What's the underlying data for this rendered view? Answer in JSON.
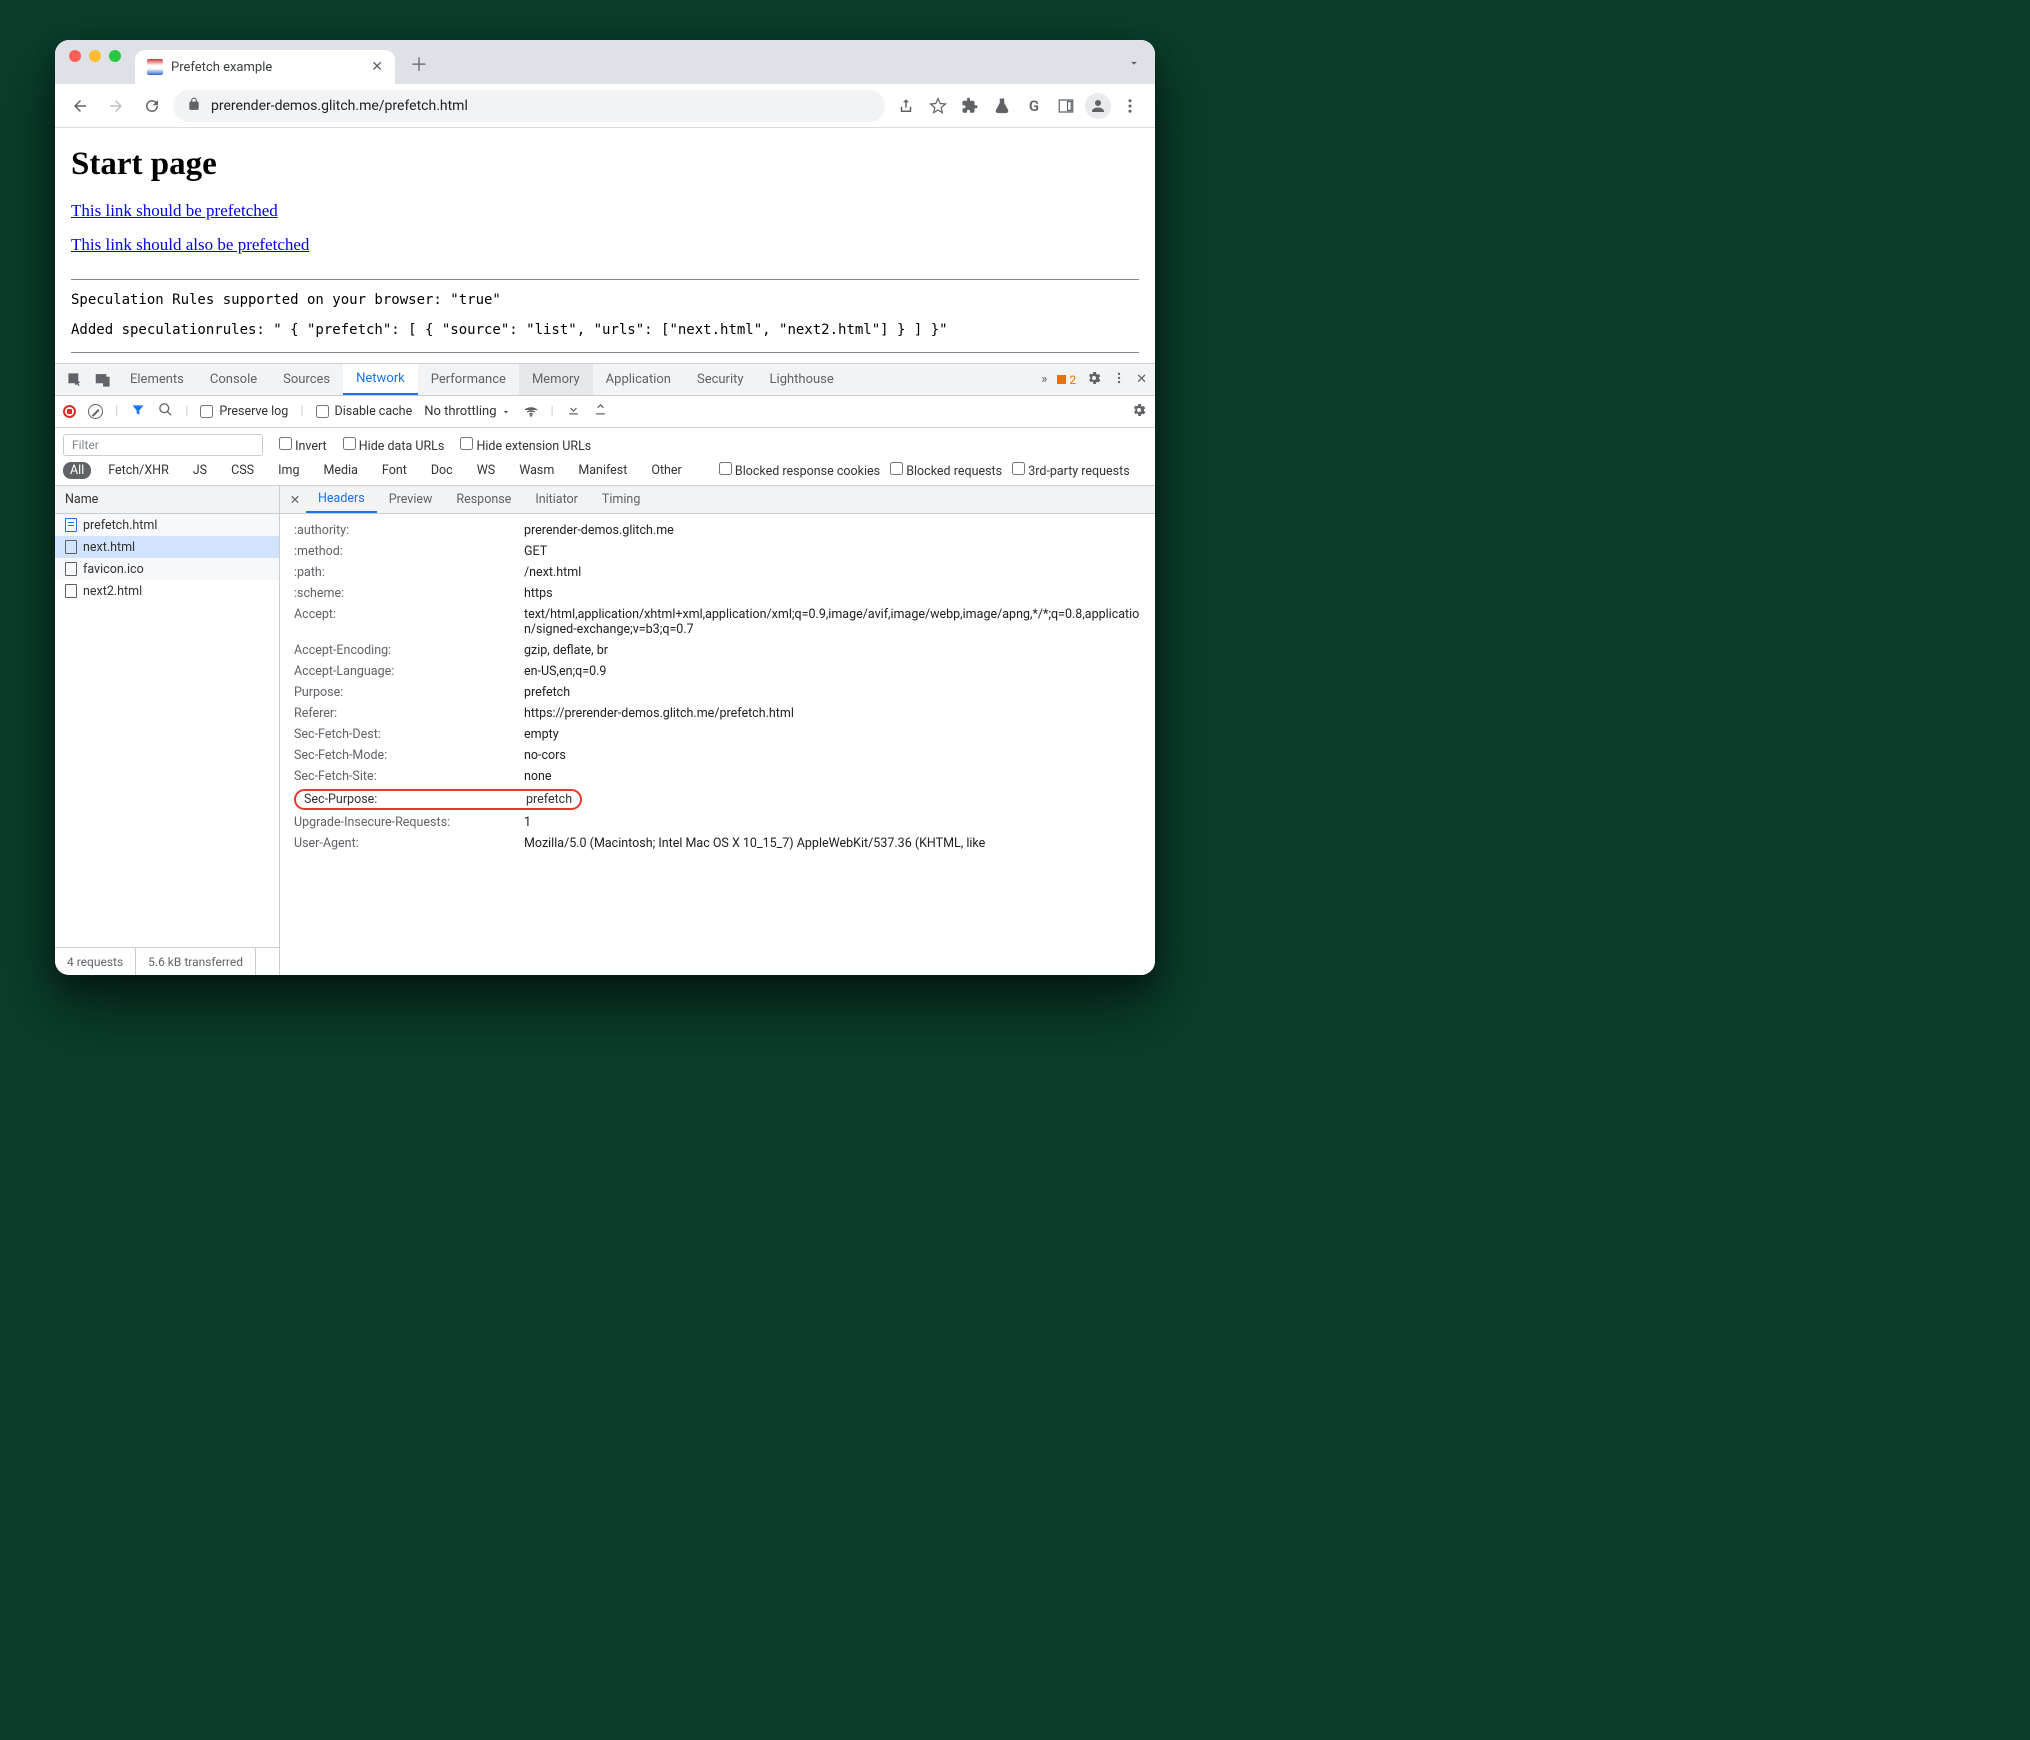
{
  "browser": {
    "tab_title": "Prefetch example",
    "url": "prerender-demos.glitch.me/prefetch.html"
  },
  "page": {
    "heading": "Start page",
    "link1": "This link should be prefetched",
    "link2": "This link should also be prefetched",
    "status1": "Speculation Rules supported on your browser: \"true\"",
    "status2": "Added speculationrules: \" { \"prefetch\": [ { \"source\": \"list\", \"urls\": [\"next.html\", \"next2.html\"] } ] }\""
  },
  "devtools": {
    "panels": [
      "Elements",
      "Console",
      "Sources",
      "Network",
      "Performance",
      "Memory",
      "Application",
      "Security",
      "Lighthouse"
    ],
    "active_panel": "Network",
    "hot_panel": "Memory",
    "warning_count": "2",
    "toolbar": {
      "preserve_log": "Preserve log",
      "disable_cache": "Disable cache",
      "throttling": "No throttling"
    },
    "filters": {
      "placeholder": "Filter",
      "invert": "Invert",
      "hide_data": "Hide data URLs",
      "hide_ext": "Hide extension URLs",
      "types": [
        "All",
        "Fetch/XHR",
        "JS",
        "CSS",
        "Img",
        "Media",
        "Font",
        "Doc",
        "WS",
        "Wasm",
        "Manifest",
        "Other"
      ],
      "blocked_cookies": "Blocked response cookies",
      "blocked_req": "Blocked requests",
      "third_party": "3rd-party requests"
    },
    "list_header": "Name",
    "requests": [
      {
        "name": "prefetch.html",
        "icon": "doc",
        "selected": false
      },
      {
        "name": "next.html",
        "icon": "file",
        "selected": true
      },
      {
        "name": "favicon.ico",
        "icon": "file",
        "selected": false
      },
      {
        "name": "next2.html",
        "icon": "file",
        "selected": false
      }
    ],
    "status": {
      "count": "4 requests",
      "transfer": "5.6 kB transferred"
    },
    "detail_tabs": [
      "Headers",
      "Preview",
      "Response",
      "Initiator",
      "Timing"
    ],
    "active_detail": "Headers",
    "headers": [
      {
        "k": ":authority:",
        "v": "prerender-demos.glitch.me"
      },
      {
        "k": ":method:",
        "v": "GET"
      },
      {
        "k": ":path:",
        "v": "/next.html"
      },
      {
        "k": ":scheme:",
        "v": "https"
      },
      {
        "k": "Accept:",
        "v": "text/html,application/xhtml+xml,application/xml;q=0.9,image/avif,image/webp,image/apng,*/*;q=0.8,application/signed-exchange;v=b3;q=0.7"
      },
      {
        "k": "Accept-Encoding:",
        "v": "gzip, deflate, br"
      },
      {
        "k": "Accept-Language:",
        "v": "en-US,en;q=0.9"
      },
      {
        "k": "Purpose:",
        "v": "prefetch"
      },
      {
        "k": "Referer:",
        "v": "https://prerender-demos.glitch.me/prefetch.html"
      },
      {
        "k": "Sec-Fetch-Dest:",
        "v": "empty"
      },
      {
        "k": "Sec-Fetch-Mode:",
        "v": "no-cors"
      },
      {
        "k": "Sec-Fetch-Site:",
        "v": "none"
      },
      {
        "k": "Sec-Purpose:",
        "v": "prefetch",
        "highlight": true
      },
      {
        "k": "Upgrade-Insecure-Requests:",
        "v": "1"
      },
      {
        "k": "User-Agent:",
        "v": "Mozilla/5.0 (Macintosh; Intel Mac OS X 10_15_7) AppleWebKit/537.36 (KHTML, like"
      }
    ]
  }
}
